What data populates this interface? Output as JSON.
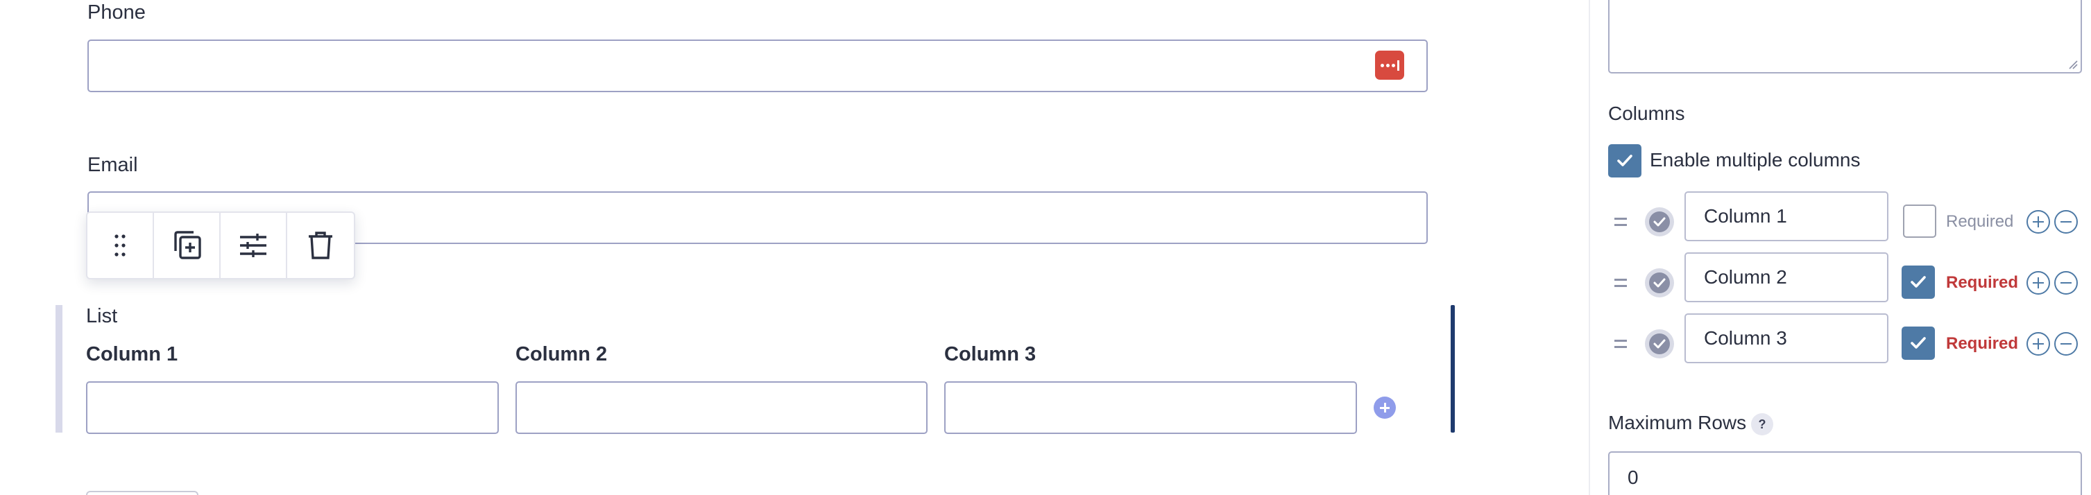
{
  "form": {
    "phone_label": "Phone",
    "email_label": "Email",
    "list_label": "List",
    "list_columns": [
      "Column 1",
      "Column 2",
      "Column 3"
    ]
  },
  "toolbar": {
    "icons": [
      "drag-handle-icon",
      "duplicate-icon",
      "settings-sliders-icon",
      "trash-icon"
    ]
  },
  "sidebar": {
    "columns_heading": "Columns",
    "enable_multiple_columns_label": "Enable multiple columns",
    "enable_multiple_columns_checked": true,
    "columns": [
      {
        "value": "Column 1",
        "required_label": "Required",
        "required": false
      },
      {
        "value": "Column 2",
        "required_label": "Required",
        "required": true
      },
      {
        "value": "Column 3",
        "required_label": "Required",
        "required": true
      }
    ],
    "max_rows_label": "Maximum Rows",
    "max_rows_help": "?",
    "max_rows_value": "0"
  },
  "colors": {
    "accent": "#4e7aa6",
    "required_red": "#c0393a",
    "password_manager_red": "#d84a3f",
    "selection_bar": "#1f3b6e"
  }
}
